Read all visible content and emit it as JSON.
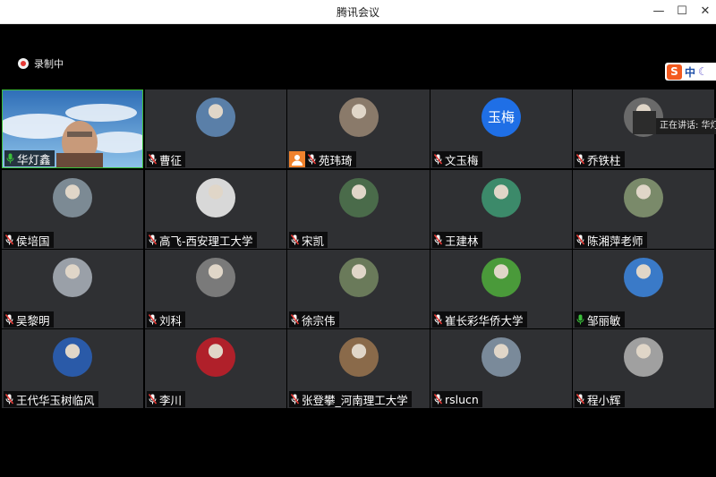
{
  "window": {
    "title": "腾讯会议"
  },
  "window_controls": {
    "minimize": "—",
    "maximize": "☐",
    "close": "✕"
  },
  "recording": {
    "label": "录制中"
  },
  "ime": {
    "logo": "S",
    "mode": "中",
    "icon": "moon-icon"
  },
  "speaking": {
    "label": "正在讲话: 华灯"
  },
  "colors": {
    "accent": "#1f6fe6",
    "active_border": "#3bbf3b",
    "host_badge": "#f0822d",
    "tile_bg": "#2f3033"
  },
  "participants": [
    {
      "name": "华灯鑫",
      "mic": "on",
      "video": true
    },
    {
      "name": "曹征",
      "mic": "muted",
      "avatar": "photo"
    },
    {
      "name": "苑玮琦",
      "mic": "muted",
      "avatar": "photo",
      "host": true
    },
    {
      "name": "文玉梅",
      "mic": "muted",
      "avatar_text": "玉梅"
    },
    {
      "name": "乔铁柱",
      "mic": "muted",
      "avatar": "photo"
    },
    {
      "name": "侯培国",
      "mic": "muted",
      "avatar": "photo"
    },
    {
      "name": "高飞-西安理工大学",
      "mic": "muted",
      "avatar": "photo"
    },
    {
      "name": "宋凯",
      "mic": "muted",
      "avatar": "photo"
    },
    {
      "name": "王建林",
      "mic": "muted",
      "avatar": "photo"
    },
    {
      "name": "陈湘萍老师",
      "mic": "muted",
      "avatar": "photo"
    },
    {
      "name": "吴黎明",
      "mic": "muted",
      "avatar": "photo"
    },
    {
      "name": "刘科",
      "mic": "muted",
      "avatar": "photo"
    },
    {
      "name": "徐宗伟",
      "mic": "muted",
      "avatar": "photo"
    },
    {
      "name": "崔长彩华侨大学",
      "mic": "muted",
      "avatar": "photo"
    },
    {
      "name": "邹丽敏",
      "mic": "on",
      "avatar": "photo"
    },
    {
      "name": "王代华玉树临风",
      "mic": "muted",
      "avatar": "photo"
    },
    {
      "name": "李川",
      "mic": "muted",
      "avatar": "photo"
    },
    {
      "name": "张登攀_河南理工大学",
      "mic": "muted",
      "avatar": "photo"
    },
    {
      "name": "rslucn",
      "mic": "muted",
      "avatar": "photo"
    },
    {
      "name": "程小辉",
      "mic": "muted",
      "avatar": "photo"
    }
  ]
}
